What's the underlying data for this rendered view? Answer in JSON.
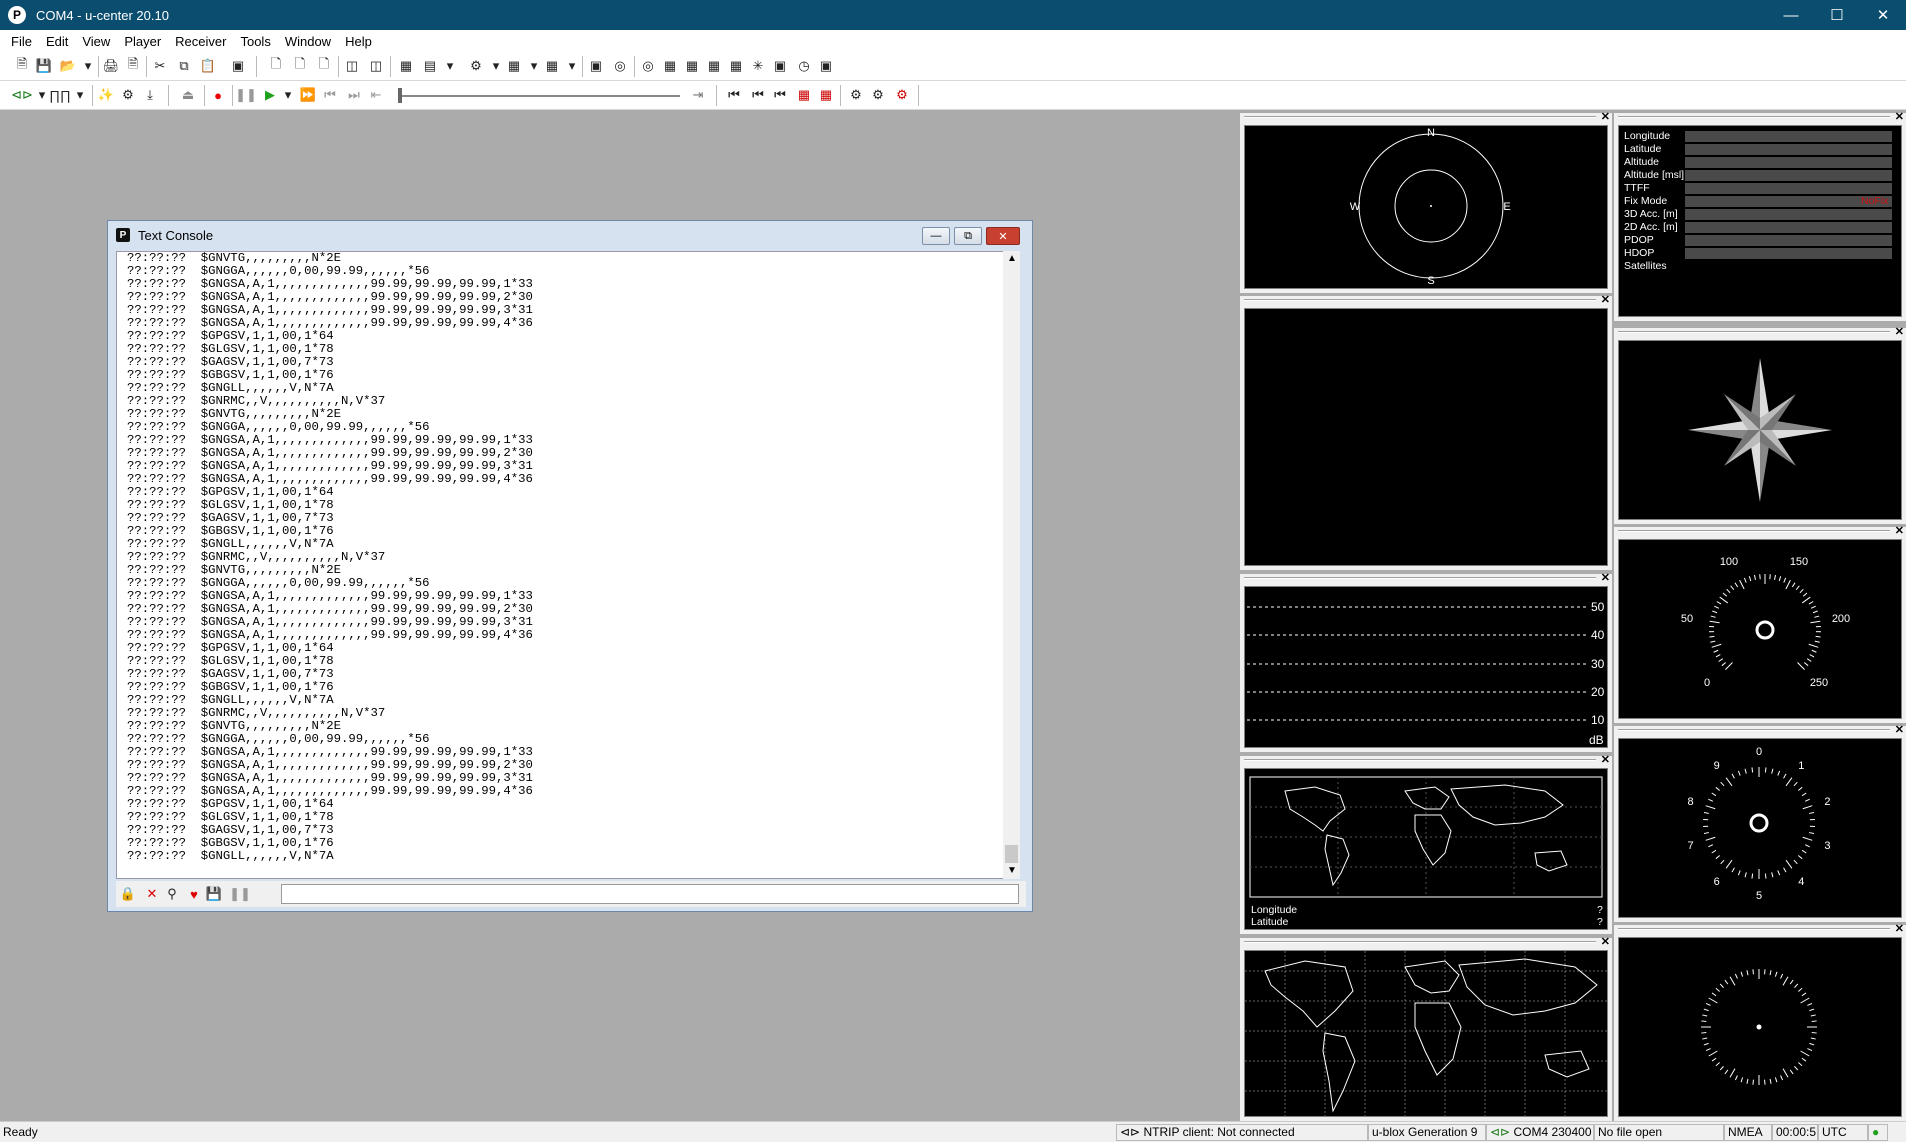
{
  "window": {
    "title": "COM4 - u-center 20.10",
    "app_icon_letter": "P"
  },
  "menu": [
    "File",
    "Edit",
    "View",
    "Player",
    "Receiver",
    "Tools",
    "Window",
    "Help"
  ],
  "console": {
    "title": "Text Console",
    "icon_letter": "P",
    "lines": [
      "??:??:??  $GNVTG,,,,,,,,,N*2E",
      "??:??:??  $GNGGA,,,,,,0,00,99.99,,,,,,*56",
      "??:??:??  $GNGSA,A,1,,,,,,,,,,,,,99.99,99.99,99.99,1*33",
      "??:??:??  $GNGSA,A,1,,,,,,,,,,,,,99.99,99.99,99.99,2*30",
      "??:??:??  $GNGSA,A,1,,,,,,,,,,,,,99.99,99.99,99.99,3*31",
      "??:??:??  $GNGSA,A,1,,,,,,,,,,,,,99.99,99.99,99.99,4*36",
      "??:??:??  $GPGSV,1,1,00,1*64",
      "??:??:??  $GLGSV,1,1,00,1*78",
      "??:??:??  $GAGSV,1,1,00,7*73",
      "??:??:??  $GBGSV,1,1,00,1*76",
      "??:??:??  $GNGLL,,,,,,V,N*7A",
      "??:??:??  $GNRMC,,V,,,,,,,,,,N,V*37",
      "??:??:??  $GNVTG,,,,,,,,,N*2E",
      "??:??:??  $GNGGA,,,,,,0,00,99.99,,,,,,*56",
      "??:??:??  $GNGSA,A,1,,,,,,,,,,,,,99.99,99.99,99.99,1*33",
      "??:??:??  $GNGSA,A,1,,,,,,,,,,,,,99.99,99.99,99.99,2*30",
      "??:??:??  $GNGSA,A,1,,,,,,,,,,,,,99.99,99.99,99.99,3*31",
      "??:??:??  $GNGSA,A,1,,,,,,,,,,,,,99.99,99.99,99.99,4*36",
      "??:??:??  $GPGSV,1,1,00,1*64",
      "??:??:??  $GLGSV,1,1,00,1*78",
      "??:??:??  $GAGSV,1,1,00,7*73",
      "??:??:??  $GBGSV,1,1,00,1*76",
      "??:??:??  $GNGLL,,,,,,V,N*7A",
      "??:??:??  $GNRMC,,V,,,,,,,,,,N,V*37",
      "??:??:??  $GNVTG,,,,,,,,,N*2E",
      "??:??:??  $GNGGA,,,,,,0,00,99.99,,,,,,*56",
      "??:??:??  $GNGSA,A,1,,,,,,,,,,,,,99.99,99.99,99.99,1*33",
      "??:??:??  $GNGSA,A,1,,,,,,,,,,,,,99.99,99.99,99.99,2*30",
      "??:??:??  $GNGSA,A,1,,,,,,,,,,,,,99.99,99.99,99.99,3*31",
      "??:??:??  $GNGSA,A,1,,,,,,,,,,,,,99.99,99.99,99.99,4*36",
      "??:??:??  $GPGSV,1,1,00,1*64",
      "??:??:??  $GLGSV,1,1,00,1*78",
      "??:??:??  $GAGSV,1,1,00,7*73",
      "??:??:??  $GBGSV,1,1,00,1*76",
      "??:??:??  $GNGLL,,,,,,V,N*7A",
      "??:??:??  $GNRMC,,V,,,,,,,,,,N,V*37",
      "??:??:??  $GNVTG,,,,,,,,,N*2E",
      "??:??:??  $GNGGA,,,,,,0,00,99.99,,,,,,*56",
      "??:??:??  $GNGSA,A,1,,,,,,,,,,,,,99.99,99.99,99.99,1*33",
      "??:??:??  $GNGSA,A,1,,,,,,,,,,,,,99.99,99.99,99.99,2*30",
      "??:??:??  $GNGSA,A,1,,,,,,,,,,,,,99.99,99.99,99.99,3*31",
      "??:??:??  $GNGSA,A,1,,,,,,,,,,,,,99.99,99.99,99.99,4*36",
      "??:??:??  $GPGSV,1,1,00,1*64",
      "??:??:??  $GLGSV,1,1,00,1*78",
      "??:??:??  $GAGSV,1,1,00,7*73",
      "??:??:??  $GBGSV,1,1,00,1*76",
      "??:??:??  $GNGLL,,,,,,V,N*7A"
    ]
  },
  "sky_view": {
    "north": "N",
    "south": "S",
    "east": "E",
    "west": "W"
  },
  "data_view": {
    "labels": [
      "Longitude",
      "Latitude",
      "Altitude",
      "Altitude [msl]",
      "TTFF",
      "Fix Mode",
      "3D Acc. [m]",
      "2D Acc. [m]",
      "PDOP",
      "HDOP",
      "Satellites"
    ],
    "fix_mode_value": "NoFix",
    "fix_mode_color": "#d01010"
  },
  "signal_view": {
    "ticks": [
      "50",
      "40",
      "30",
      "20",
      "10"
    ],
    "unit": "dB"
  },
  "speed_gauge": {
    "labels": [
      "0",
      "50",
      "100",
      "150",
      "200",
      "250"
    ]
  },
  "clock_gauge": {
    "labels": [
      "0",
      "1",
      "2",
      "3",
      "4",
      "5",
      "6",
      "7",
      "8",
      "9"
    ]
  },
  "world_map": {
    "longitude_label": "Longitude",
    "latitude_label": "Latitude",
    "longitude_value": "?",
    "latitude_value": "?"
  },
  "status": {
    "ready": "Ready",
    "ntrip": "NTRIP client: Not connected",
    "generation": "u-blox Generation 9",
    "port": "COM4 230400",
    "file": "No file open",
    "protocol": "NMEA",
    "time": "00:00:5",
    "tz": "UTC"
  }
}
